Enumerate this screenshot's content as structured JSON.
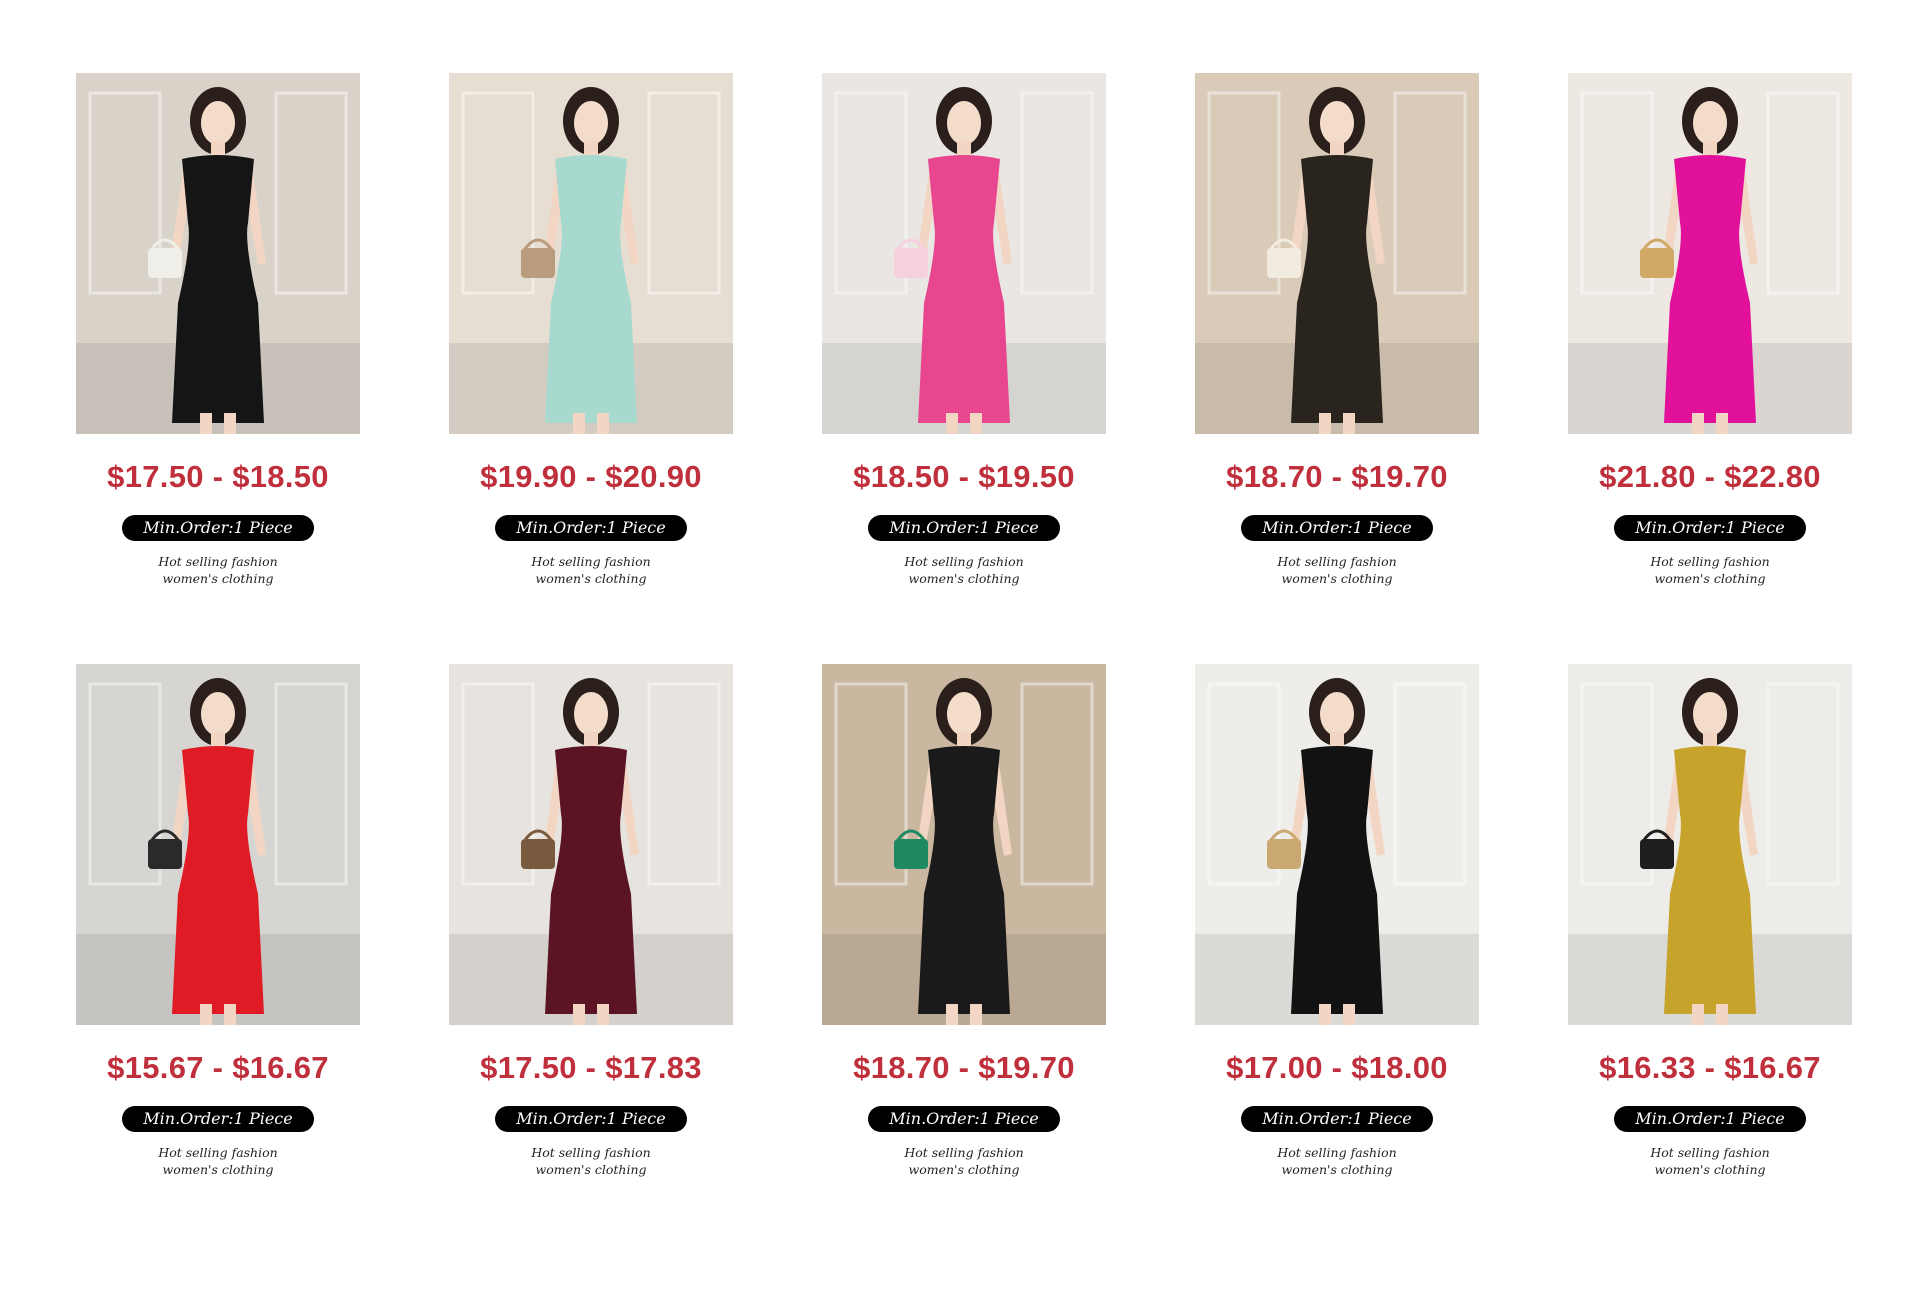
{
  "products": [
    {
      "price": "$17.50 - $18.50",
      "moq": "Min.Order:1 Piece",
      "desc_line1": "Hot selling fashion",
      "desc_line2": "women's clothing",
      "image": "woman-in-black-off-shoulder-dress-bedroom",
      "bg": "#d9d2c9",
      "dress": "#151515",
      "accent": "#f0eee8"
    },
    {
      "price": "$19.90 - $20.90",
      "moq": "Min.Order:1 Piece",
      "desc_line1": "Hot selling fashion",
      "desc_line2": "women's clothing",
      "image": "woman-in-mint-puff-sleeve-dress-bathroom",
      "bg": "#e7ded3",
      "dress": "#a7d9cf",
      "accent": "#b99b7d"
    },
    {
      "price": "$18.50 - $19.50",
      "moq": "Min.Order:1 Piece",
      "desc_line1": "Hot selling fashion",
      "desc_line2": "women's clothing",
      "image": "woman-in-pink-gingham-dress-marble-bathroom",
      "bg": "#e9e6e3",
      "dress": "#e8478f",
      "accent": "#f7d0df"
    },
    {
      "price": "$18.70 - $19.70",
      "moq": "Min.Order:1 Piece",
      "desc_line1": "Hot selling fashion",
      "desc_line2": "women's clothing",
      "image": "woman-in-black-lace-mermaid-dress-living-room",
      "bg": "#d9cbb8",
      "dress": "#2a241f",
      "accent": "#f2ebe0"
    },
    {
      "price": "$21.80 - $22.80",
      "moq": "Min.Order:1 Piece",
      "desc_line1": "Hot selling fashion",
      "desc_line2": "women's clothing",
      "image": "woman-in-magenta-bow-sleeve-dress-parlor",
      "bg": "#ede8e2",
      "dress": "#e1119c",
      "accent": "#d1a966"
    },
    {
      "price": "$15.67 - $16.67",
      "moq": "Min.Order:1 Piece",
      "desc_line1": "Hot selling fashion",
      "desc_line2": "women's clothing",
      "image": "woman-in-red-off-shoulder-dress-with-black-bag",
      "bg": "#d6d5d1",
      "dress": "#df1b26",
      "accent": "#2a2a2a"
    },
    {
      "price": "$17.50 - $17.83",
      "moq": "Min.Order:1 Piece",
      "desc_line1": "Hot selling fashion",
      "desc_line2": "women's clothing",
      "image": "woman-in-burgundy-long-sleeve-maxi-dress",
      "bg": "#e7e3df",
      "dress": "#5a1424",
      "accent": "#7a5a3e"
    },
    {
      "price": "$18.70 - $19.70",
      "moq": "Min.Order:1 Piece",
      "desc_line1": "Hot selling fashion",
      "desc_line2": "women's clothing",
      "image": "woman-in-black-tulle-dress-with-green-sequin-top",
      "bg": "#c9b7a0",
      "dress": "#1a1a1a",
      "accent": "#1f8a62"
    },
    {
      "price": "$17.00 - $18.00",
      "moq": "Min.Order:1 Piece",
      "desc_line1": "Hot selling fashion",
      "desc_line2": "women's clothing",
      "image": "woman-in-black-lace-sleeve-midi-dress",
      "bg": "#efedea",
      "dress": "#121212",
      "accent": "#c9a872"
    },
    {
      "price": "$16.33 - $16.67",
      "moq": "Min.Order:1 Piece",
      "desc_line1": "Hot selling fashion",
      "desc_line2": "women's clothing",
      "image": "woman-in-mustard-snake-print-dress",
      "bg": "#eeece8",
      "dress": "#c6a32a",
      "accent": "#1e1e1e"
    }
  ]
}
